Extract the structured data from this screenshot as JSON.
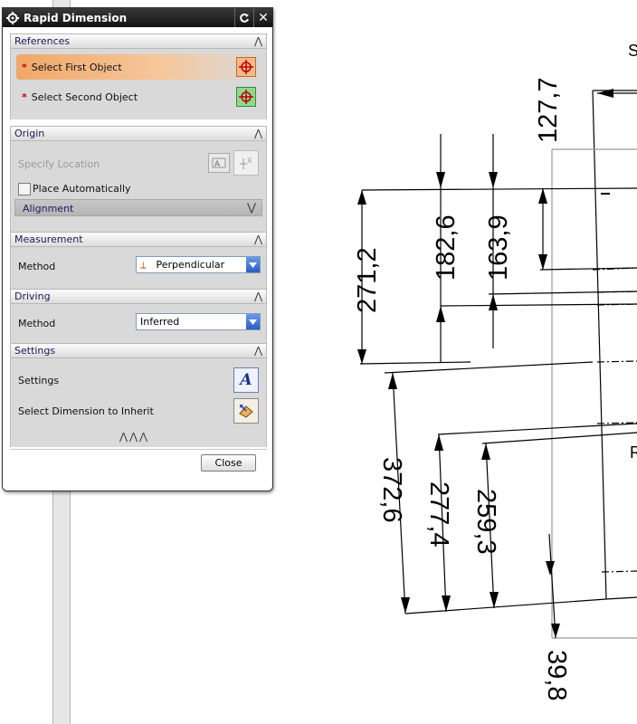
{
  "dialog": {
    "title": "Rapid Dimension",
    "references": {
      "header": "References",
      "first_object": "Select First Object",
      "second_object": "Select Second Object"
    },
    "origin": {
      "header": "Origin",
      "specify_location": "Specify Location",
      "place_automatically": "Place Automatically",
      "alignment": "Alignment"
    },
    "measurement": {
      "header": "Measurement",
      "method_label": "Method",
      "method_value": "Perpendicular"
    },
    "driving": {
      "header": "Driving",
      "method_label": "Method",
      "method_value": "Inferred"
    },
    "settings": {
      "header": "Settings",
      "settings_label": "Settings",
      "inherit_label": "Select Dimension to Inherit",
      "icon_text": "A"
    },
    "close_label": "Close"
  },
  "drawing": {
    "labels": {
      "top_s": "S",
      "r_label": "R",
      "d127": "127,7",
      "d182": "182,6",
      "d163": "163,9",
      "d271": "271,2",
      "d372": "372,6",
      "d277": "277,4",
      "d259": "259,3",
      "d39": "39,8"
    }
  },
  "colors": {
    "title_bar": "#111111",
    "selected_row": "#f3a66a",
    "dropdown_button": "#2a5cc4"
  }
}
